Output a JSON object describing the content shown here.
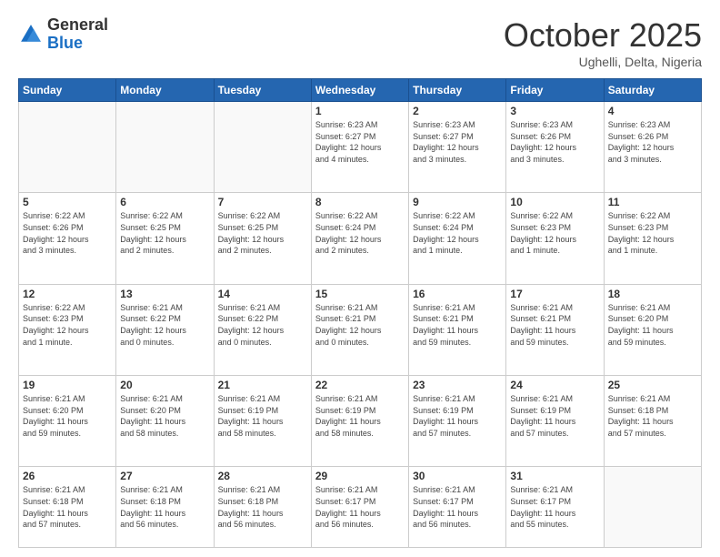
{
  "header": {
    "logo_general": "General",
    "logo_blue": "Blue",
    "month_title": "October 2025",
    "subtitle": "Ughelli, Delta, Nigeria"
  },
  "days_of_week": [
    "Sunday",
    "Monday",
    "Tuesday",
    "Wednesday",
    "Thursday",
    "Friday",
    "Saturday"
  ],
  "weeks": [
    [
      {
        "day": "",
        "info": ""
      },
      {
        "day": "",
        "info": ""
      },
      {
        "day": "",
        "info": ""
      },
      {
        "day": "1",
        "info": "Sunrise: 6:23 AM\nSunset: 6:27 PM\nDaylight: 12 hours\nand 4 minutes."
      },
      {
        "day": "2",
        "info": "Sunrise: 6:23 AM\nSunset: 6:27 PM\nDaylight: 12 hours\nand 3 minutes."
      },
      {
        "day": "3",
        "info": "Sunrise: 6:23 AM\nSunset: 6:26 PM\nDaylight: 12 hours\nand 3 minutes."
      },
      {
        "day": "4",
        "info": "Sunrise: 6:23 AM\nSunset: 6:26 PM\nDaylight: 12 hours\nand 3 minutes."
      }
    ],
    [
      {
        "day": "5",
        "info": "Sunrise: 6:22 AM\nSunset: 6:26 PM\nDaylight: 12 hours\nand 3 minutes."
      },
      {
        "day": "6",
        "info": "Sunrise: 6:22 AM\nSunset: 6:25 PM\nDaylight: 12 hours\nand 2 minutes."
      },
      {
        "day": "7",
        "info": "Sunrise: 6:22 AM\nSunset: 6:25 PM\nDaylight: 12 hours\nand 2 minutes."
      },
      {
        "day": "8",
        "info": "Sunrise: 6:22 AM\nSunset: 6:24 PM\nDaylight: 12 hours\nand 2 minutes."
      },
      {
        "day": "9",
        "info": "Sunrise: 6:22 AM\nSunset: 6:24 PM\nDaylight: 12 hours\nand 1 minute."
      },
      {
        "day": "10",
        "info": "Sunrise: 6:22 AM\nSunset: 6:23 PM\nDaylight: 12 hours\nand 1 minute."
      },
      {
        "day": "11",
        "info": "Sunrise: 6:22 AM\nSunset: 6:23 PM\nDaylight: 12 hours\nand 1 minute."
      }
    ],
    [
      {
        "day": "12",
        "info": "Sunrise: 6:22 AM\nSunset: 6:23 PM\nDaylight: 12 hours\nand 1 minute."
      },
      {
        "day": "13",
        "info": "Sunrise: 6:21 AM\nSunset: 6:22 PM\nDaylight: 12 hours\nand 0 minutes."
      },
      {
        "day": "14",
        "info": "Sunrise: 6:21 AM\nSunset: 6:22 PM\nDaylight: 12 hours\nand 0 minutes."
      },
      {
        "day": "15",
        "info": "Sunrise: 6:21 AM\nSunset: 6:21 PM\nDaylight: 12 hours\nand 0 minutes."
      },
      {
        "day": "16",
        "info": "Sunrise: 6:21 AM\nSunset: 6:21 PM\nDaylight: 11 hours\nand 59 minutes."
      },
      {
        "day": "17",
        "info": "Sunrise: 6:21 AM\nSunset: 6:21 PM\nDaylight: 11 hours\nand 59 minutes."
      },
      {
        "day": "18",
        "info": "Sunrise: 6:21 AM\nSunset: 6:20 PM\nDaylight: 11 hours\nand 59 minutes."
      }
    ],
    [
      {
        "day": "19",
        "info": "Sunrise: 6:21 AM\nSunset: 6:20 PM\nDaylight: 11 hours\nand 59 minutes."
      },
      {
        "day": "20",
        "info": "Sunrise: 6:21 AM\nSunset: 6:20 PM\nDaylight: 11 hours\nand 58 minutes."
      },
      {
        "day": "21",
        "info": "Sunrise: 6:21 AM\nSunset: 6:19 PM\nDaylight: 11 hours\nand 58 minutes."
      },
      {
        "day": "22",
        "info": "Sunrise: 6:21 AM\nSunset: 6:19 PM\nDaylight: 11 hours\nand 58 minutes."
      },
      {
        "day": "23",
        "info": "Sunrise: 6:21 AM\nSunset: 6:19 PM\nDaylight: 11 hours\nand 57 minutes."
      },
      {
        "day": "24",
        "info": "Sunrise: 6:21 AM\nSunset: 6:19 PM\nDaylight: 11 hours\nand 57 minutes."
      },
      {
        "day": "25",
        "info": "Sunrise: 6:21 AM\nSunset: 6:18 PM\nDaylight: 11 hours\nand 57 minutes."
      }
    ],
    [
      {
        "day": "26",
        "info": "Sunrise: 6:21 AM\nSunset: 6:18 PM\nDaylight: 11 hours\nand 57 minutes."
      },
      {
        "day": "27",
        "info": "Sunrise: 6:21 AM\nSunset: 6:18 PM\nDaylight: 11 hours\nand 56 minutes."
      },
      {
        "day": "28",
        "info": "Sunrise: 6:21 AM\nSunset: 6:18 PM\nDaylight: 11 hours\nand 56 minutes."
      },
      {
        "day": "29",
        "info": "Sunrise: 6:21 AM\nSunset: 6:17 PM\nDaylight: 11 hours\nand 56 minutes."
      },
      {
        "day": "30",
        "info": "Sunrise: 6:21 AM\nSunset: 6:17 PM\nDaylight: 11 hours\nand 56 minutes."
      },
      {
        "day": "31",
        "info": "Sunrise: 6:21 AM\nSunset: 6:17 PM\nDaylight: 11 hours\nand 55 minutes."
      },
      {
        "day": "",
        "info": ""
      }
    ]
  ]
}
